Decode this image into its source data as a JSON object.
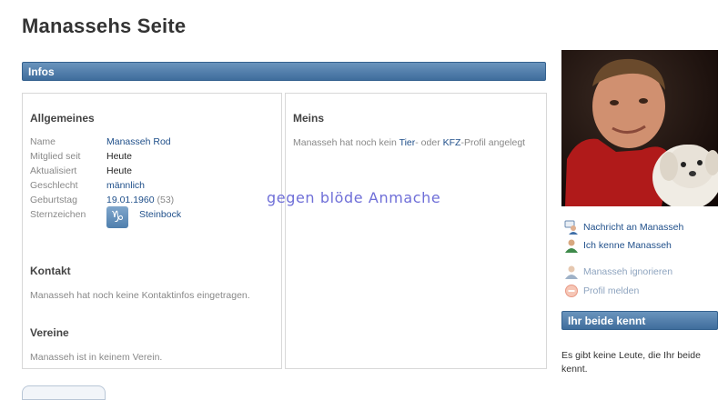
{
  "page": {
    "title": "Manassehs Seite"
  },
  "infos": {
    "header": "Infos",
    "allgemeines": {
      "heading": "Allgemeines",
      "rows": [
        {
          "label": "Name",
          "value": "Manasseh Rod"
        },
        {
          "label": "Mitglied seit",
          "value": "Heute"
        },
        {
          "label": "Aktualisiert",
          "value": "Heute"
        },
        {
          "label": "Geschlecht",
          "value": "männlich"
        },
        {
          "label": "Geburtstag",
          "value": "19.01.1960",
          "extra": "(53)"
        },
        {
          "label": "Sternzeichen",
          "value": "Steinbock"
        }
      ]
    },
    "kontakt": {
      "heading": "Kontakt",
      "text": "Manasseh hat noch keine Kontaktinfos eingetragen."
    },
    "vereine": {
      "heading": "Vereine",
      "text": "Manasseh ist in keinem Verein."
    },
    "meins": {
      "heading": "Meins",
      "text_before": "Manasseh hat noch kein ",
      "link_tier": "Tier",
      "text_mid": "- oder ",
      "link_kfz": "KFZ",
      "text_after": "-Profil angelegt"
    }
  },
  "overlay": {
    "watermark": "gegen blöde Anmache"
  },
  "sidebar": {
    "actions": [
      {
        "label": "Nachricht an Manasseh",
        "icon": "message-user-icon"
      },
      {
        "label": "Ich kenne Manasseh",
        "icon": "know-user-icon"
      },
      {
        "label": "Manasseh ignorieren",
        "icon": "ignore-user-icon"
      },
      {
        "label": "Profil melden",
        "icon": "report-icon"
      }
    ],
    "kennt": {
      "header": "Ihr beide kennt",
      "text": "Es gibt keine Leute, die Ihr beide kennt."
    }
  },
  "colors": {
    "bar": "#4f7fad",
    "link": "#1f4f8a",
    "watermark": "#6f6fd8"
  }
}
